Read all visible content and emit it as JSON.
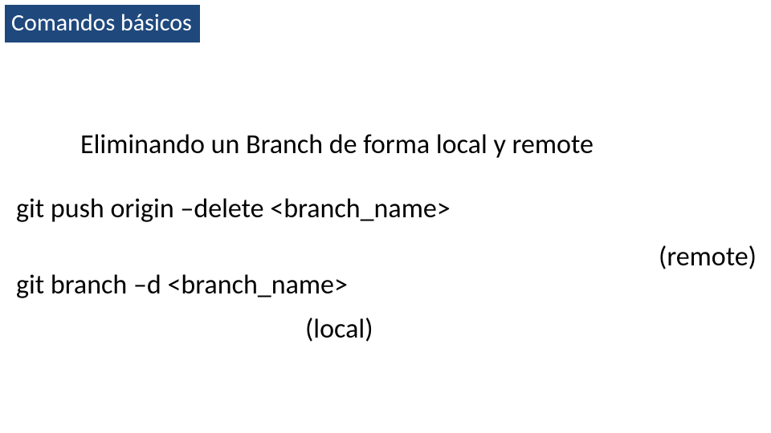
{
  "title": "Comandos básicos",
  "subtitle": "Eliminando un Branch de forma local y remote",
  "commands": {
    "remote": "git push origin –delete <branch_name>",
    "remote_label": "(remote)",
    "local": "git branch –d <branch_name>",
    "local_label": "(local)"
  }
}
